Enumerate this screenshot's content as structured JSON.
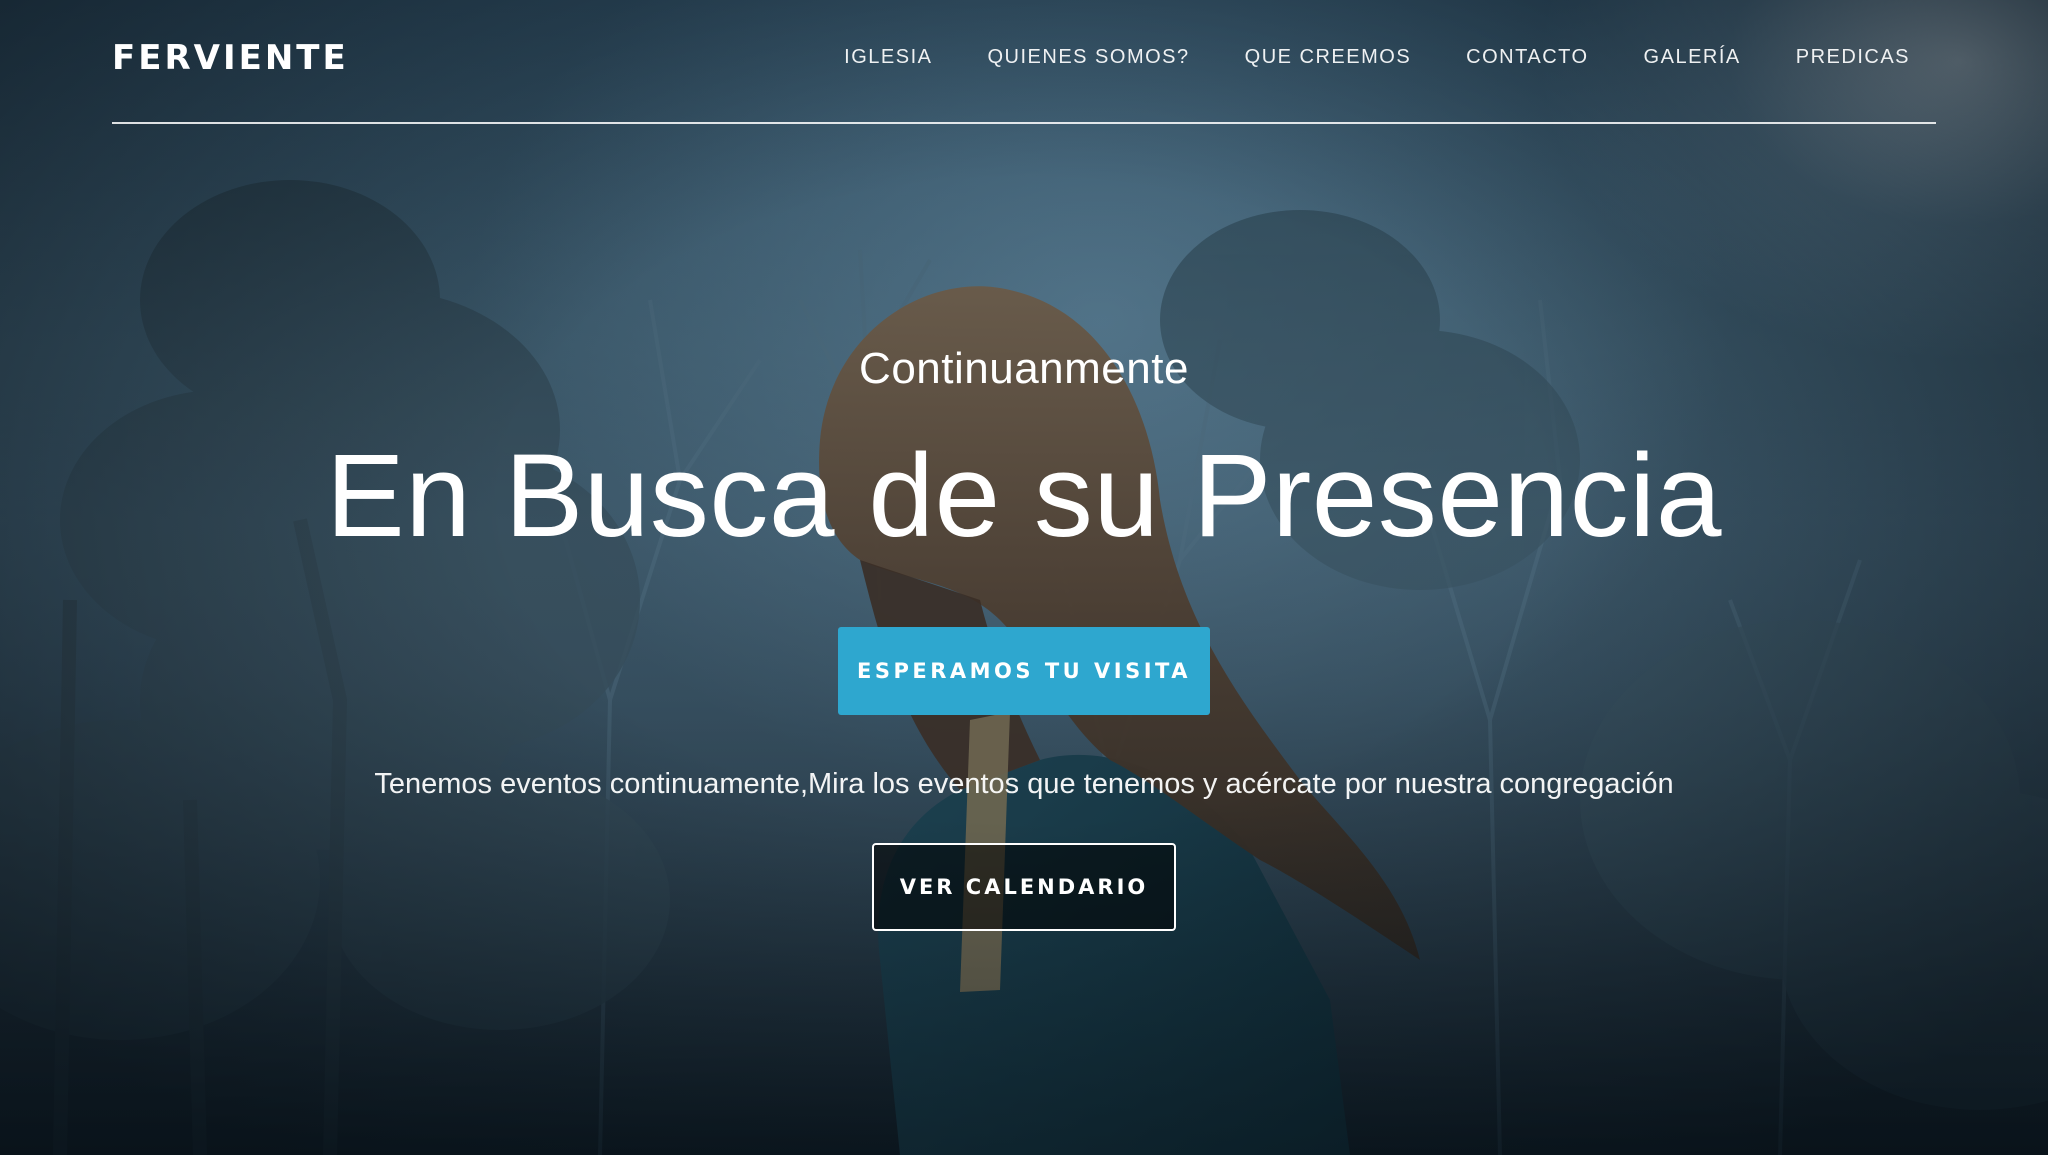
{
  "brand": {
    "name": "FERVIENTE"
  },
  "nav": {
    "items": [
      {
        "label": "IGLESIA"
      },
      {
        "label": "QUIENES SOMOS?"
      },
      {
        "label": "QUE CREEMOS"
      },
      {
        "label": "CONTACTO"
      },
      {
        "label": "GALERÍA"
      },
      {
        "label": "PREDICAS"
      }
    ]
  },
  "hero": {
    "kicker": "Continuanmente",
    "headline": "En Busca de su Presencia",
    "primary_cta": "ESPERAMOS TU VISITA",
    "tagline": "Tenemos eventos continuamente,Mira los eventos que tenemos y acércate por nuestra congregación",
    "secondary_cta": "VER CALENDARIO"
  },
  "colors": {
    "accent": "#2ea7cf",
    "text": "#ffffff",
    "background": "#1f3747"
  }
}
